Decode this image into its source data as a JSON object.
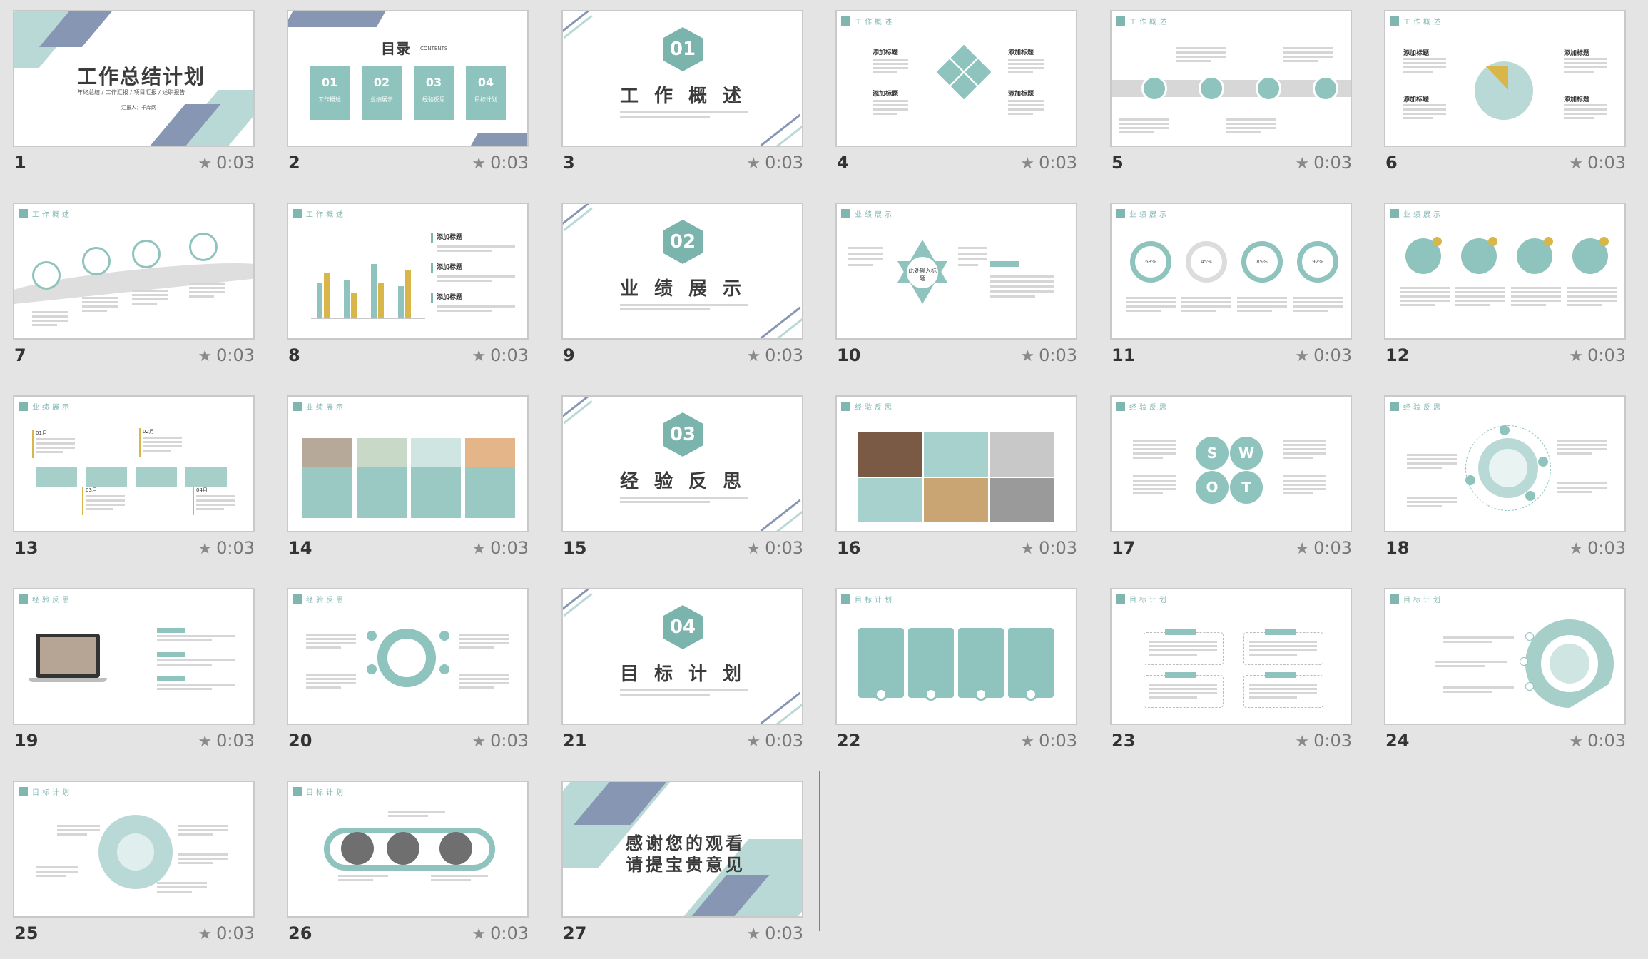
{
  "slides": [
    {
      "number": "1",
      "timing": "0:03",
      "title": "工作总结计划",
      "subtitle": "年终总结 / 工作汇报 / 项目汇报 / 述职报告",
      "reporter": "汇报人：千库网"
    },
    {
      "number": "2",
      "timing": "0:03",
      "title": "目录",
      "subtitle": "CONTENTS",
      "items": [
        {
          "num": "01",
          "label": "工作概述"
        },
        {
          "num": "02",
          "label": "业绩展示"
        },
        {
          "num": "03",
          "label": "经验反思"
        },
        {
          "num": "04",
          "label": "目标计划"
        }
      ]
    },
    {
      "number": "3",
      "timing": "0:03",
      "hex": "01",
      "title": "工作概述"
    },
    {
      "number": "4",
      "timing": "0:03",
      "header": "工作概述",
      "labels": [
        "添加标题",
        "添加标题",
        "添加标题",
        "添加标题"
      ]
    },
    {
      "number": "5",
      "timing": "0:03",
      "header": "工作概述"
    },
    {
      "number": "6",
      "timing": "0:03",
      "header": "工作概述",
      "labels": [
        "添加标题",
        "添加标题",
        "添加标题",
        "添加标题"
      ]
    },
    {
      "number": "7",
      "timing": "0:03",
      "header": "工作概述"
    },
    {
      "number": "8",
      "timing": "0:03",
      "header": "工作概述",
      "labels": [
        "添加标题",
        "添加标题",
        "添加标题"
      ]
    },
    {
      "number": "9",
      "timing": "0:03",
      "hex": "02",
      "title": "业绩展示"
    },
    {
      "number": "10",
      "timing": "0:03",
      "header": "业绩展示",
      "center": "此处输入标题"
    },
    {
      "number": "11",
      "timing": "0:03",
      "header": "业绩展示",
      "percents": [
        "63%",
        "45%",
        "85%",
        "92%"
      ]
    },
    {
      "number": "12",
      "timing": "0:03",
      "header": "业绩展示"
    },
    {
      "number": "13",
      "timing": "0:03",
      "header": "业绩展示",
      "months": [
        "01月",
        "02月",
        "03月",
        "04月"
      ]
    },
    {
      "number": "14",
      "timing": "0:03",
      "header": "业绩展示"
    },
    {
      "number": "15",
      "timing": "0:03",
      "hex": "03",
      "title": "经验反思"
    },
    {
      "number": "16",
      "timing": "0:03",
      "header": "经验反思"
    },
    {
      "number": "17",
      "timing": "0:03",
      "header": "经验反思",
      "swot": [
        "S",
        "W",
        "O",
        "T"
      ]
    },
    {
      "number": "18",
      "timing": "0:03",
      "header": "经验反思"
    },
    {
      "number": "19",
      "timing": "0:03",
      "header": "经验反思"
    },
    {
      "number": "20",
      "timing": "0:03",
      "header": "经验反思"
    },
    {
      "number": "21",
      "timing": "0:03",
      "hex": "04",
      "title": "目标计划"
    },
    {
      "number": "22",
      "timing": "0:03",
      "header": "目标计划"
    },
    {
      "number": "23",
      "timing": "0:03",
      "header": "目标计划"
    },
    {
      "number": "24",
      "timing": "0:03",
      "header": "目标计划"
    },
    {
      "number": "25",
      "timing": "0:03",
      "header": "目标计划"
    },
    {
      "number": "26",
      "timing": "0:03",
      "header": "目标计划"
    },
    {
      "number": "27",
      "timing": "0:03",
      "title_line1": "感谢您的观看",
      "title_line2": "请提宝贵意见"
    }
  ],
  "colors": {
    "teal": "#7fb6b0",
    "slate": "#8696b3",
    "light_teal": "#b9d9d6",
    "gold": "#d8b64a"
  }
}
